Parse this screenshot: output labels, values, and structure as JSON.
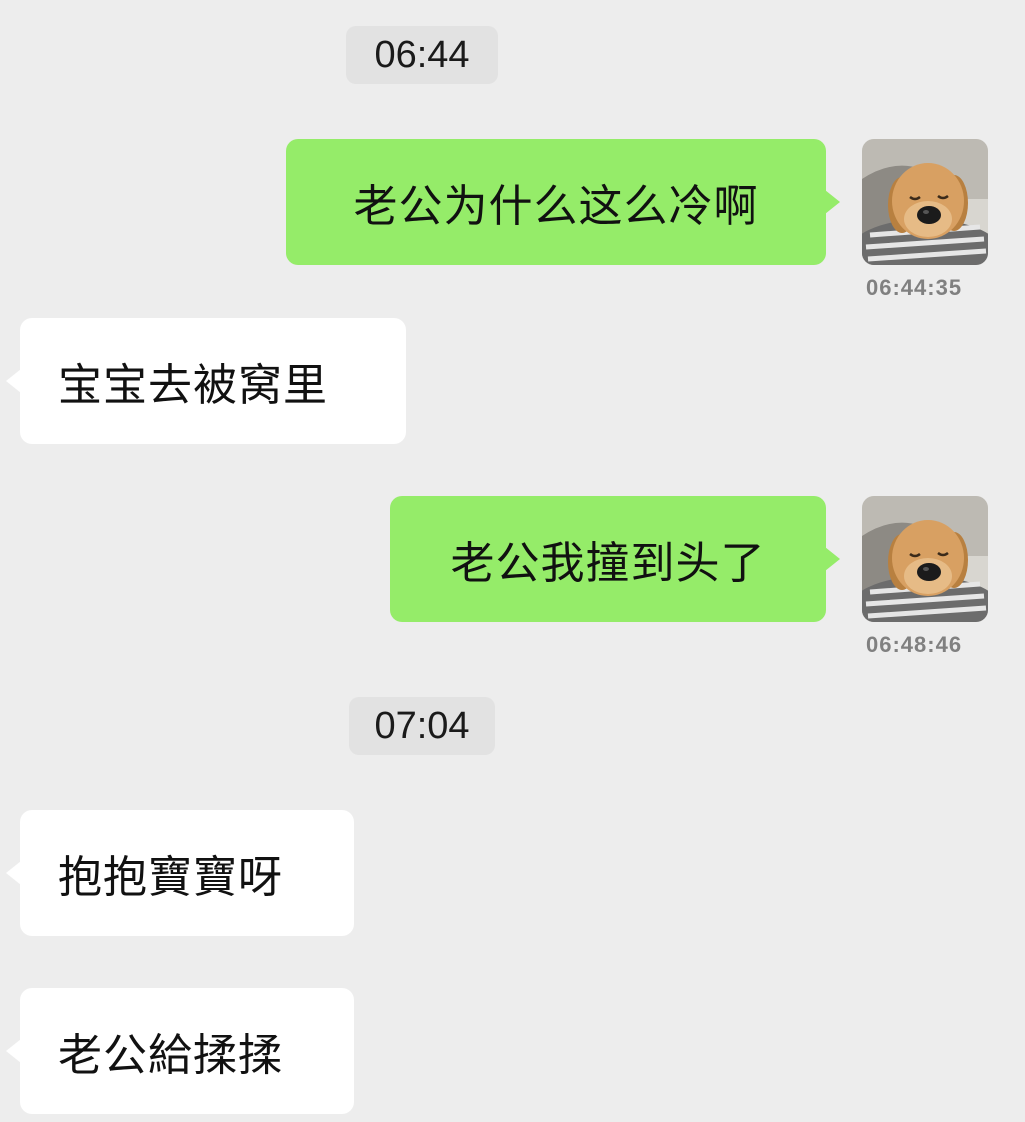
{
  "chat": {
    "time_separators": [
      "06:44",
      "07:04"
    ],
    "messages": [
      {
        "direction": "outgoing",
        "text": "老公为什么这么冷啊",
        "timestamp": "06:44:35",
        "avatar": "puppy-avatar"
      },
      {
        "direction": "incoming",
        "text": "宝宝去被窝里"
      },
      {
        "direction": "outgoing",
        "text": "老公我撞到头了",
        "timestamp": "06:48:46",
        "avatar": "puppy-avatar"
      },
      {
        "direction": "incoming",
        "text": "抱抱寶寶呀"
      },
      {
        "direction": "incoming",
        "text": "老公給揉揉"
      }
    ]
  },
  "colors": {
    "background": "#ededed",
    "outgoing_bubble": "#95ec69",
    "incoming_bubble": "#ffffff",
    "time_pill": "#e2e2e2",
    "timestamp_text": "#808080"
  }
}
